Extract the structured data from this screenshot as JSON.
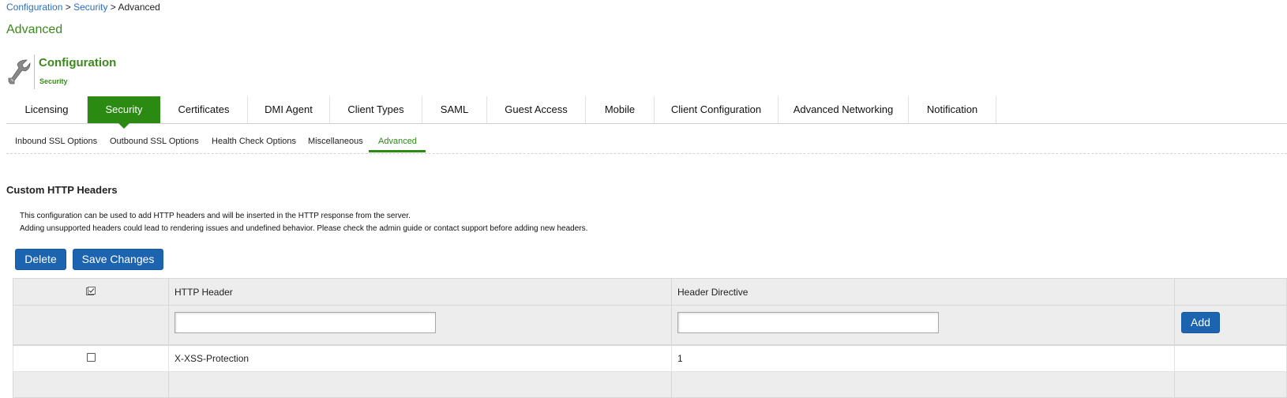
{
  "breadcrumb": {
    "items": [
      "Configuration",
      "Security",
      "Advanced"
    ],
    "separator": ">"
  },
  "page_title": "Advanced",
  "header": {
    "title": "Configuration",
    "subtitle": "Security",
    "icon": "wrench-icon"
  },
  "main_tabs": [
    {
      "label": "Licensing"
    },
    {
      "label": "Security",
      "active": true
    },
    {
      "label": "Certificates"
    },
    {
      "label": "DMI Agent"
    },
    {
      "label": "Client Types"
    },
    {
      "label": "SAML"
    },
    {
      "label": "Guest Access"
    },
    {
      "label": "Mobile"
    },
    {
      "label": "Client Configuration"
    },
    {
      "label": "Advanced Networking"
    },
    {
      "label": "Notification"
    }
  ],
  "sub_tabs": [
    {
      "label": "Inbound SSL Options"
    },
    {
      "label": "Outbound SSL Options"
    },
    {
      "label": "Health Check Options"
    },
    {
      "label": "Miscellaneous"
    },
    {
      "label": "Advanced",
      "active": true
    }
  ],
  "section": {
    "title": "Custom HTTP Headers",
    "description_line1": "This configuration can be used to add HTTP headers and will be inserted in the HTTP response from the server.",
    "description_line2": "Adding unsupported headers could lead to rendering issues and undefined behavior. Please check the admin guide or contact support before adding new headers."
  },
  "actions": {
    "delete_label": "Delete",
    "save_label": "Save Changes"
  },
  "table": {
    "columns": [
      "HTTP Header",
      "Header Directive"
    ],
    "new_row": {
      "header_value": "",
      "directive_value": "",
      "add_label": "Add"
    },
    "rows": [
      {
        "header": "X-XSS-Protection",
        "directive": "1",
        "checked": false
      }
    ]
  },
  "colors": {
    "brand_green": "#3b8a1d",
    "tab_active": "#2a8a12",
    "button_blue": "#1c63b0",
    "link_blue": "#2a6ebb"
  }
}
